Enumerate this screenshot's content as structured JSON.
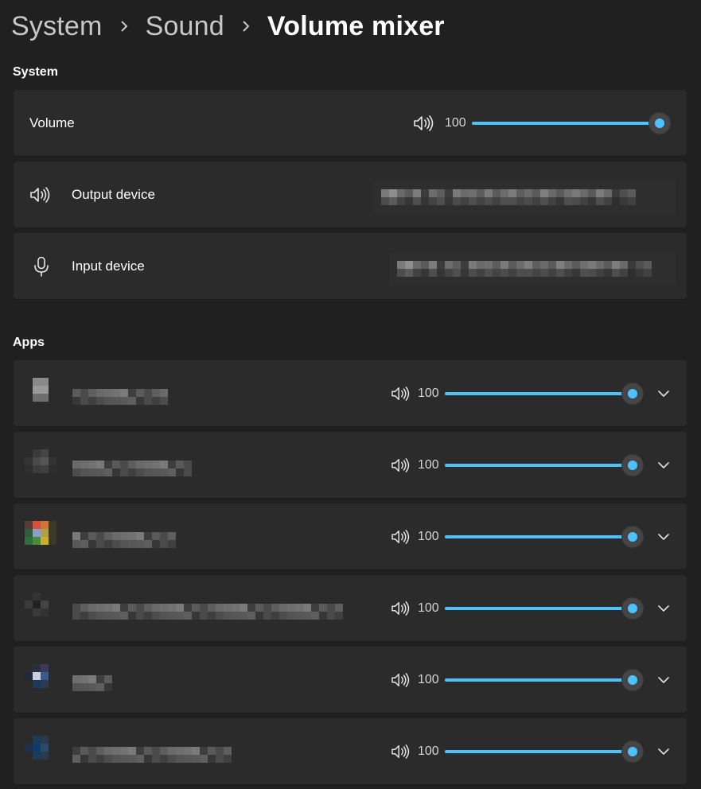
{
  "breadcrumb": {
    "items": [
      "System",
      "Sound"
    ],
    "current": "Volume mixer"
  },
  "system_section": {
    "title": "System",
    "volume": {
      "label": "Volume",
      "value": "100",
      "level": 1.0,
      "icon": "speaker-icon"
    },
    "output_device": {
      "label": "Output device",
      "icon": "speaker-icon",
      "selected_value_redacted": true
    },
    "input_device": {
      "label": "Input device",
      "icon": "microphone-icon",
      "selected_value_redacted": true
    }
  },
  "apps_section": {
    "title": "Apps",
    "apps": [
      {
        "name_redacted": true,
        "volume": "100",
        "level": 1.0
      },
      {
        "name_redacted": true,
        "volume": "100",
        "level": 1.0
      },
      {
        "name_redacted": true,
        "volume": "100",
        "level": 1.0
      },
      {
        "name_redacted": true,
        "volume": "100",
        "level": 1.0
      },
      {
        "name_redacted": true,
        "volume": "100",
        "level": 1.0
      },
      {
        "name_redacted": true,
        "volume": "100",
        "level": 1.0
      }
    ]
  },
  "colors": {
    "background": "#202020",
    "card": "#2b2b2b",
    "accent": "#4cc2ff",
    "text": "#ffffff",
    "muted_text": "#c8c8c8"
  }
}
